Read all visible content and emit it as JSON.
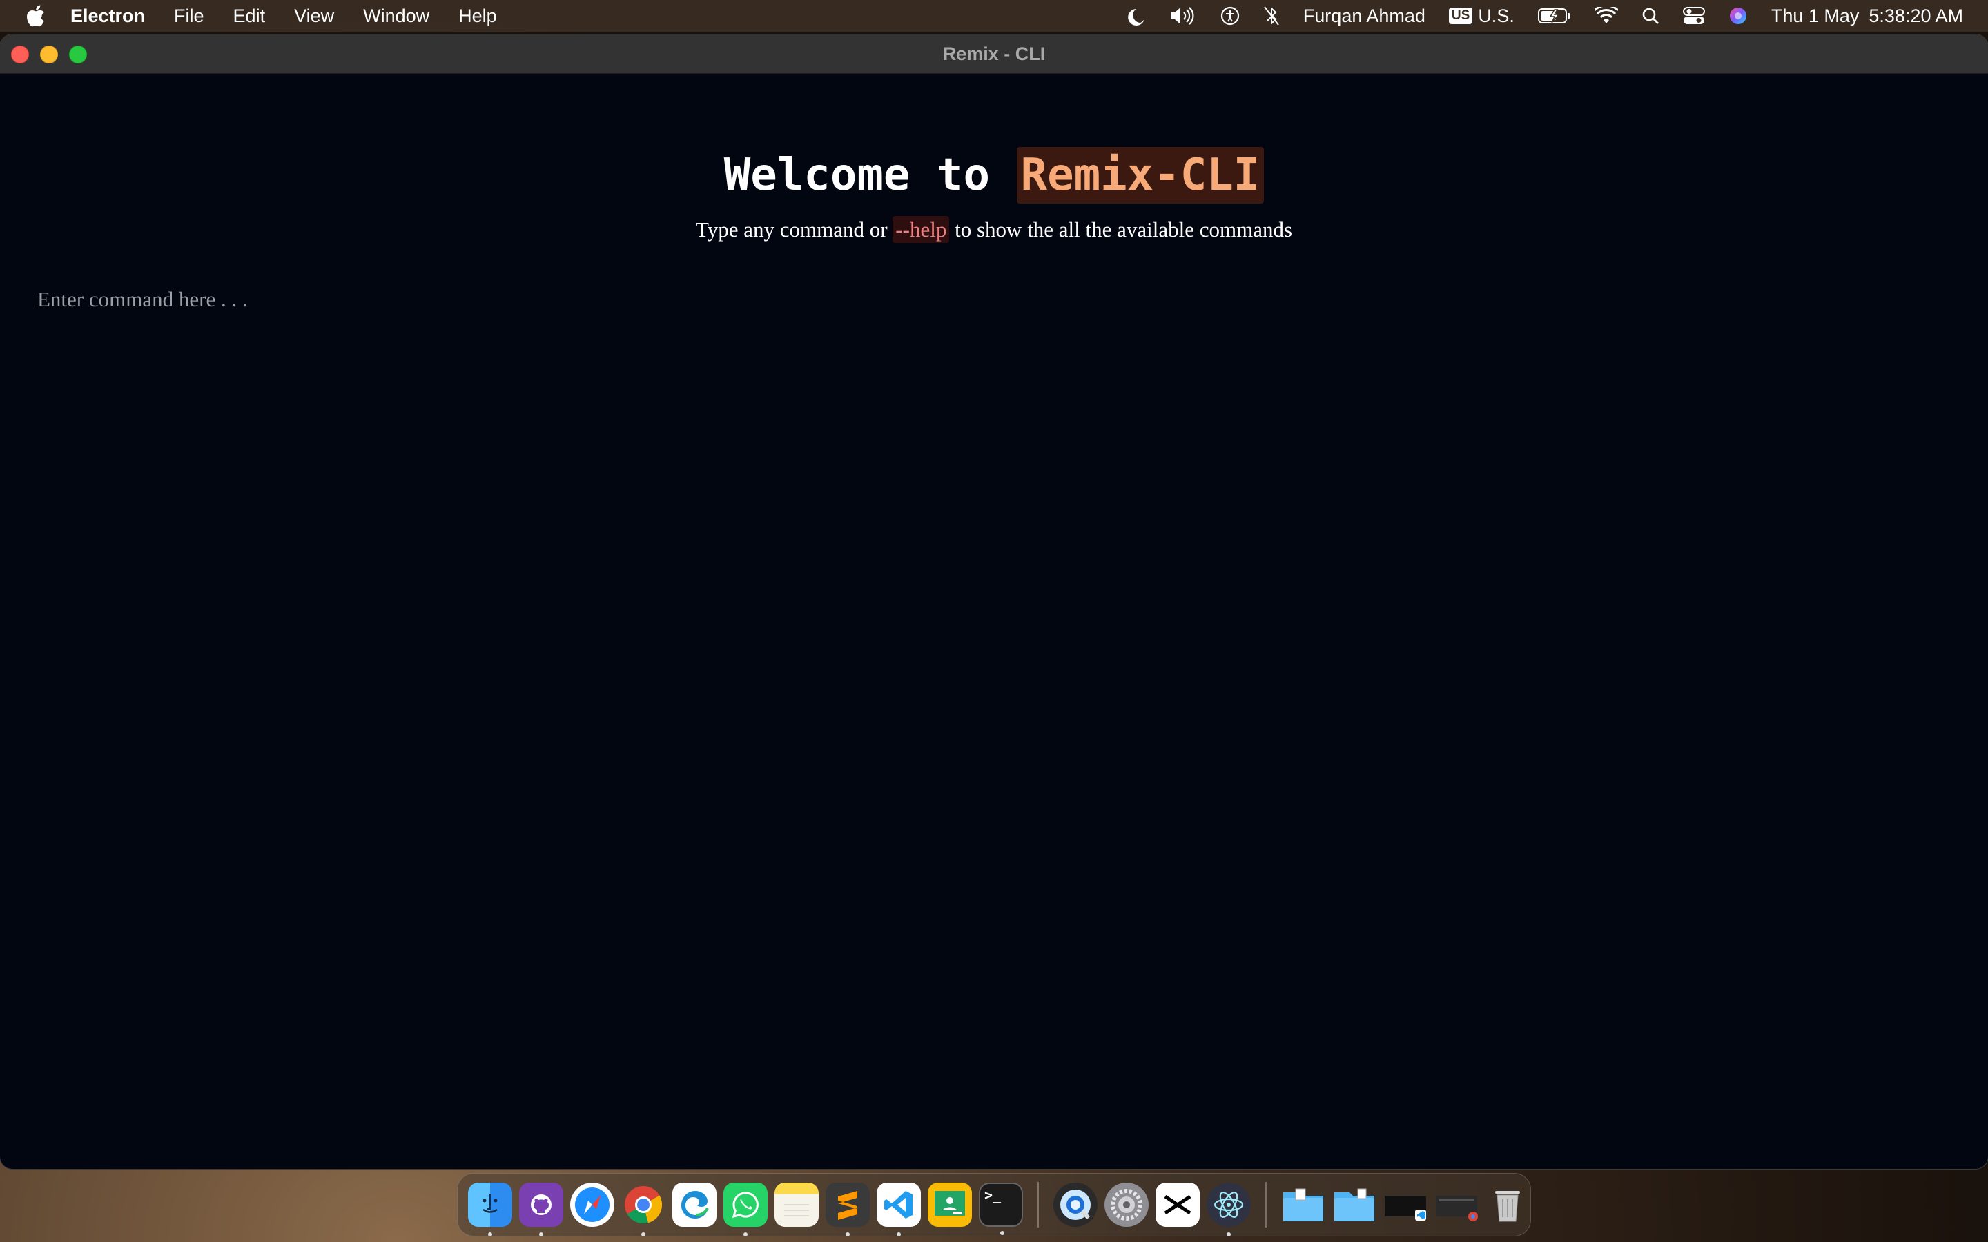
{
  "menubar": {
    "app_name": "Electron",
    "items": [
      "File",
      "Edit",
      "View",
      "Window",
      "Help"
    ],
    "user_name": "Furqan Ahmad",
    "input_source_badge": "US",
    "input_source_label": "U.S.",
    "date": "Thu 1 May",
    "time": "5:38:20 AM"
  },
  "window": {
    "title": "Remix - CLI"
  },
  "main": {
    "welcome_prefix": "Welcome to ",
    "welcome_brand": "Remix-CLI",
    "subtitle_before": "Type any command or ",
    "subtitle_code": "--help",
    "subtitle_after": " to show the all the available commands",
    "command_placeholder": "Enter command here . . ."
  },
  "colors": {
    "window_background": "#020611",
    "brand_text": "#f7a978",
    "brand_highlight": "#3b1810",
    "code_text": "#f08080"
  },
  "dock": {
    "apps": [
      {
        "icon": "finder-icon",
        "running": true
      },
      {
        "icon": "github-desktop-icon",
        "running": true
      },
      {
        "icon": "safari-icon",
        "running": false
      },
      {
        "icon": "chrome-icon",
        "running": true
      },
      {
        "icon": "edge-icon",
        "running": false
      },
      {
        "icon": "whatsapp-icon",
        "running": true
      },
      {
        "icon": "notes-icon",
        "running": false
      },
      {
        "icon": "sublime-text-icon",
        "running": true
      },
      {
        "icon": "vscode-icon",
        "running": true
      },
      {
        "icon": "google-classroom-icon",
        "running": false
      },
      {
        "icon": "terminal-icon",
        "running": true
      },
      {
        "icon": "quicktime-icon",
        "running": false
      },
      {
        "icon": "system-settings-icon",
        "running": false
      },
      {
        "icon": "capcut-icon",
        "running": false
      },
      {
        "icon": "electron-icon",
        "running": true
      },
      {
        "icon": "folder-documents-icon",
        "running": false
      },
      {
        "icon": "folder-downloads-icon",
        "running": false
      },
      {
        "icon": "vscode-window-thumbnail-icon",
        "running": false
      },
      {
        "icon": "chrome-window-thumbnail-icon",
        "running": false
      },
      {
        "icon": "trash-icon",
        "running": false
      }
    ]
  }
}
